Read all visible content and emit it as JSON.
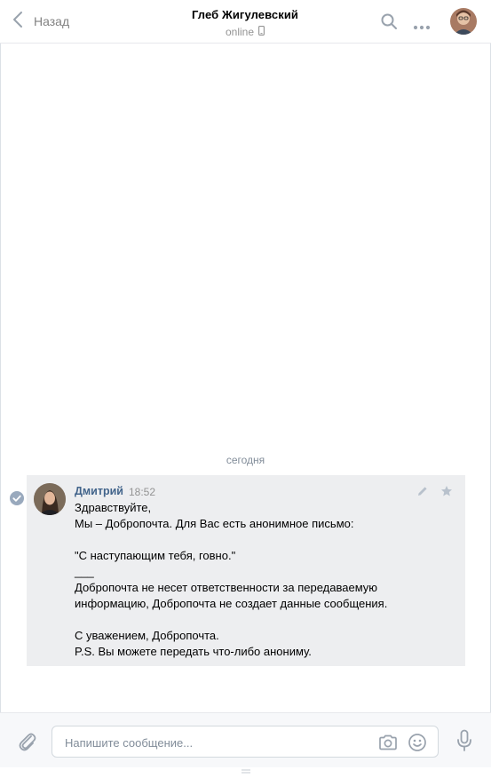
{
  "header": {
    "back_label": "Назад",
    "peer_name": "Глеб Жигулевский",
    "peer_status": "online"
  },
  "history": {
    "date_separator": "сегодня"
  },
  "message": {
    "author": "Дмитрий",
    "time": "18:52",
    "lines": [
      "Здравствуйте,",
      "Мы – Добропочта. Для Вас есть анонимное письмо:",
      "",
      "\"С наступающим тебя, говно.\"",
      "___",
      "Добропочта не несет ответственности за передаваемую",
      "информацию, Добропочта не создает данные сообщения.",
      "",
      "С уважением, Добропочта.",
      "P.S. Вы можете передать что-либо анониму."
    ]
  },
  "composer": {
    "placeholder": "Напишите сообщение...",
    "value": ""
  },
  "colors": {
    "accent_link": "#42648b",
    "icon_gray": "#99a2ad",
    "message_bg": "#edeef0",
    "check_blue": "#99a9bd"
  },
  "icons": [
    "chevron-left-icon",
    "mobile-icon",
    "search-icon",
    "more-icon",
    "check-icon",
    "edit-icon",
    "star-icon",
    "attach-icon",
    "camera-icon",
    "smile-icon",
    "mic-icon"
  ]
}
